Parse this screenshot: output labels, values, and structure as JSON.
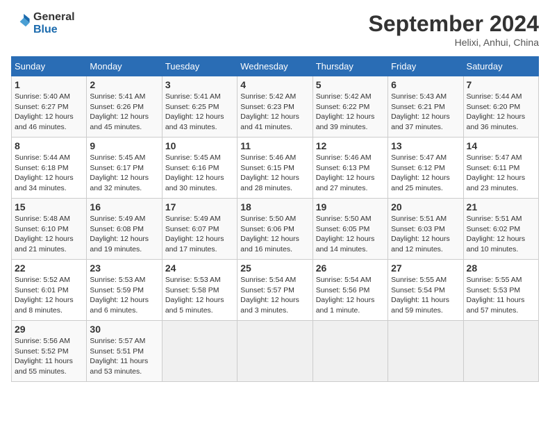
{
  "header": {
    "logo_line1": "General",
    "logo_line2": "Blue",
    "month_title": "September 2024",
    "subtitle": "Helixi, Anhui, China"
  },
  "weekdays": [
    "Sunday",
    "Monday",
    "Tuesday",
    "Wednesday",
    "Thursday",
    "Friday",
    "Saturday"
  ],
  "weeks": [
    [
      {
        "day": "1",
        "info": "Sunrise: 5:40 AM\nSunset: 6:27 PM\nDaylight: 12 hours\nand 46 minutes."
      },
      {
        "day": "2",
        "info": "Sunrise: 5:41 AM\nSunset: 6:26 PM\nDaylight: 12 hours\nand 45 minutes."
      },
      {
        "day": "3",
        "info": "Sunrise: 5:41 AM\nSunset: 6:25 PM\nDaylight: 12 hours\nand 43 minutes."
      },
      {
        "day": "4",
        "info": "Sunrise: 5:42 AM\nSunset: 6:23 PM\nDaylight: 12 hours\nand 41 minutes."
      },
      {
        "day": "5",
        "info": "Sunrise: 5:42 AM\nSunset: 6:22 PM\nDaylight: 12 hours\nand 39 minutes."
      },
      {
        "day": "6",
        "info": "Sunrise: 5:43 AM\nSunset: 6:21 PM\nDaylight: 12 hours\nand 37 minutes."
      },
      {
        "day": "7",
        "info": "Sunrise: 5:44 AM\nSunset: 6:20 PM\nDaylight: 12 hours\nand 36 minutes."
      }
    ],
    [
      {
        "day": "8",
        "info": "Sunrise: 5:44 AM\nSunset: 6:18 PM\nDaylight: 12 hours\nand 34 minutes."
      },
      {
        "day": "9",
        "info": "Sunrise: 5:45 AM\nSunset: 6:17 PM\nDaylight: 12 hours\nand 32 minutes."
      },
      {
        "day": "10",
        "info": "Sunrise: 5:45 AM\nSunset: 6:16 PM\nDaylight: 12 hours\nand 30 minutes."
      },
      {
        "day": "11",
        "info": "Sunrise: 5:46 AM\nSunset: 6:15 PM\nDaylight: 12 hours\nand 28 minutes."
      },
      {
        "day": "12",
        "info": "Sunrise: 5:46 AM\nSunset: 6:13 PM\nDaylight: 12 hours\nand 27 minutes."
      },
      {
        "day": "13",
        "info": "Sunrise: 5:47 AM\nSunset: 6:12 PM\nDaylight: 12 hours\nand 25 minutes."
      },
      {
        "day": "14",
        "info": "Sunrise: 5:47 AM\nSunset: 6:11 PM\nDaylight: 12 hours\nand 23 minutes."
      }
    ],
    [
      {
        "day": "15",
        "info": "Sunrise: 5:48 AM\nSunset: 6:10 PM\nDaylight: 12 hours\nand 21 minutes."
      },
      {
        "day": "16",
        "info": "Sunrise: 5:49 AM\nSunset: 6:08 PM\nDaylight: 12 hours\nand 19 minutes."
      },
      {
        "day": "17",
        "info": "Sunrise: 5:49 AM\nSunset: 6:07 PM\nDaylight: 12 hours\nand 17 minutes."
      },
      {
        "day": "18",
        "info": "Sunrise: 5:50 AM\nSunset: 6:06 PM\nDaylight: 12 hours\nand 16 minutes."
      },
      {
        "day": "19",
        "info": "Sunrise: 5:50 AM\nSunset: 6:05 PM\nDaylight: 12 hours\nand 14 minutes."
      },
      {
        "day": "20",
        "info": "Sunrise: 5:51 AM\nSunset: 6:03 PM\nDaylight: 12 hours\nand 12 minutes."
      },
      {
        "day": "21",
        "info": "Sunrise: 5:51 AM\nSunset: 6:02 PM\nDaylight: 12 hours\nand 10 minutes."
      }
    ],
    [
      {
        "day": "22",
        "info": "Sunrise: 5:52 AM\nSunset: 6:01 PM\nDaylight: 12 hours\nand 8 minutes."
      },
      {
        "day": "23",
        "info": "Sunrise: 5:53 AM\nSunset: 5:59 PM\nDaylight: 12 hours\nand 6 minutes."
      },
      {
        "day": "24",
        "info": "Sunrise: 5:53 AM\nSunset: 5:58 PM\nDaylight: 12 hours\nand 5 minutes."
      },
      {
        "day": "25",
        "info": "Sunrise: 5:54 AM\nSunset: 5:57 PM\nDaylight: 12 hours\nand 3 minutes."
      },
      {
        "day": "26",
        "info": "Sunrise: 5:54 AM\nSunset: 5:56 PM\nDaylight: 12 hours\nand 1 minute."
      },
      {
        "day": "27",
        "info": "Sunrise: 5:55 AM\nSunset: 5:54 PM\nDaylight: 11 hours\nand 59 minutes."
      },
      {
        "day": "28",
        "info": "Sunrise: 5:55 AM\nSunset: 5:53 PM\nDaylight: 11 hours\nand 57 minutes."
      }
    ],
    [
      {
        "day": "29",
        "info": "Sunrise: 5:56 AM\nSunset: 5:52 PM\nDaylight: 11 hours\nand 55 minutes."
      },
      {
        "day": "30",
        "info": "Sunrise: 5:57 AM\nSunset: 5:51 PM\nDaylight: 11 hours\nand 53 minutes."
      },
      {
        "day": "",
        "info": ""
      },
      {
        "day": "",
        "info": ""
      },
      {
        "day": "",
        "info": ""
      },
      {
        "day": "",
        "info": ""
      },
      {
        "day": "",
        "info": ""
      }
    ]
  ]
}
